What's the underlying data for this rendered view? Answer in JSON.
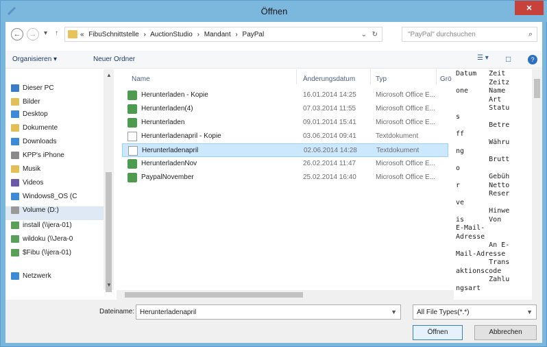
{
  "window": {
    "title": "Öffnen",
    "close_glyph": "×"
  },
  "nav": {
    "back_glyph": "←",
    "forward_glyph": "→",
    "dropdown_glyph": "▾",
    "up_glyph": "↑",
    "breadcrumb": [
      "«",
      "FibuSchnittstelle",
      "›",
      "AuctionStudio",
      "›",
      "Mandant",
      "›",
      "PayPal"
    ],
    "address_dropdown_glyph": "⌄",
    "refresh_glyph": "↻",
    "search_placeholder": "\"PayPal\" durchsuchen",
    "search_glyph": "⌕"
  },
  "toolbar": {
    "organize": "Organisieren ▾",
    "new_folder": "Neuer Ordner",
    "view_glyph": "☰ ▾",
    "pane_glyph": "□",
    "help_glyph": "?"
  },
  "sidebar": {
    "items": [
      {
        "label": "Dieser PC",
        "icon": "pc-icon",
        "color": "#3a7cc5"
      },
      {
        "label": "Bilder",
        "icon": "pictures-icon",
        "color": "#e3bf57"
      },
      {
        "label": "Desktop",
        "icon": "desktop-icon",
        "color": "#3d8ad6"
      },
      {
        "label": "Dokumente",
        "icon": "documents-icon",
        "color": "#e3bf57"
      },
      {
        "label": "Downloads",
        "icon": "downloads-icon",
        "color": "#3d8ad6"
      },
      {
        "label": "KPP's iPhone",
        "icon": "phone-icon",
        "color": "#8a8a8a"
      },
      {
        "label": "Musik",
        "icon": "music-icon",
        "color": "#e3bf57"
      },
      {
        "label": "Videos",
        "icon": "videos-icon",
        "color": "#6b5aa8"
      },
      {
        "label": "Windows8_OS (C",
        "icon": "drive-icon",
        "color": "#3d8ad6"
      },
      {
        "label": "Volume (D:)",
        "icon": "drive-icon",
        "color": "#9a9a9a"
      },
      {
        "label": "install (\\\\jera-01)",
        "icon": "network-drive-icon",
        "color": "#5aa05a"
      },
      {
        "label": "wildoku (\\\\Jera-0",
        "icon": "network-drive-icon",
        "color": "#5aa05a"
      },
      {
        "label": "$Fibu (\\\\jera-01)",
        "icon": "network-drive-icon",
        "color": "#5aa05a"
      },
      {
        "label": "Netzwerk",
        "icon": "network-icon",
        "color": "#3d8ad6"
      }
    ]
  },
  "columns": {
    "name": "Name",
    "date": "Änderungsdatum",
    "type": "Typ",
    "size": "Grö"
  },
  "files": [
    {
      "name": "Herunterladen - Kopie",
      "date": "16.01.2014 14:25",
      "type": "Microsoft Office E...",
      "kind": "excel"
    },
    {
      "name": "Herunterladen(4)",
      "date": "07.03.2014 11:55",
      "type": "Microsoft Office E...",
      "kind": "excel"
    },
    {
      "name": "Herunterladen",
      "date": "09.01.2014 15:41",
      "type": "Microsoft Office E...",
      "kind": "excel"
    },
    {
      "name": "Herunterladenapril - Kopie",
      "date": "03.06.2014 09:41",
      "type": "Textdokument",
      "kind": "text"
    },
    {
      "name": "Herunterladenapril",
      "date": "02.06.2014 14:28",
      "type": "Textdokument",
      "kind": "text",
      "selected": true
    },
    {
      "name": "HerunterladenNov",
      "date": "26.02.2014 11:47",
      "type": "Microsoft Office E...",
      "kind": "excel"
    },
    {
      "name": "PaypalNovember",
      "date": "25.02.2014 16:40",
      "type": "Microsoft Office E...",
      "kind": "excel"
    }
  ],
  "preview": {
    "lines": [
      "Datum   Zeit",
      "        Zeitz",
      "one     Name",
      "        Art",
      "        Statu",
      "s",
      "        Betre",
      "ff",
      "        Währu",
      "ng",
      "        Brutt",
      "o",
      "        Gebüh",
      "r       Netto",
      "        Reser",
      "ve",
      "        Hinwe",
      "is      Von",
      "E-Mail-",
      "Adresse",
      "        An E-",
      "Mail-Adresse",
      "        Trans",
      "aktionscode",
      "        Zahlu",
      "ngsart"
    ]
  },
  "bottom": {
    "filename_label": "Dateiname:",
    "filename_value": "Herunterladenapril",
    "filetype": "All File Types(*.*)",
    "open_label": "Öffnen",
    "cancel_label": "Abbrechen"
  }
}
